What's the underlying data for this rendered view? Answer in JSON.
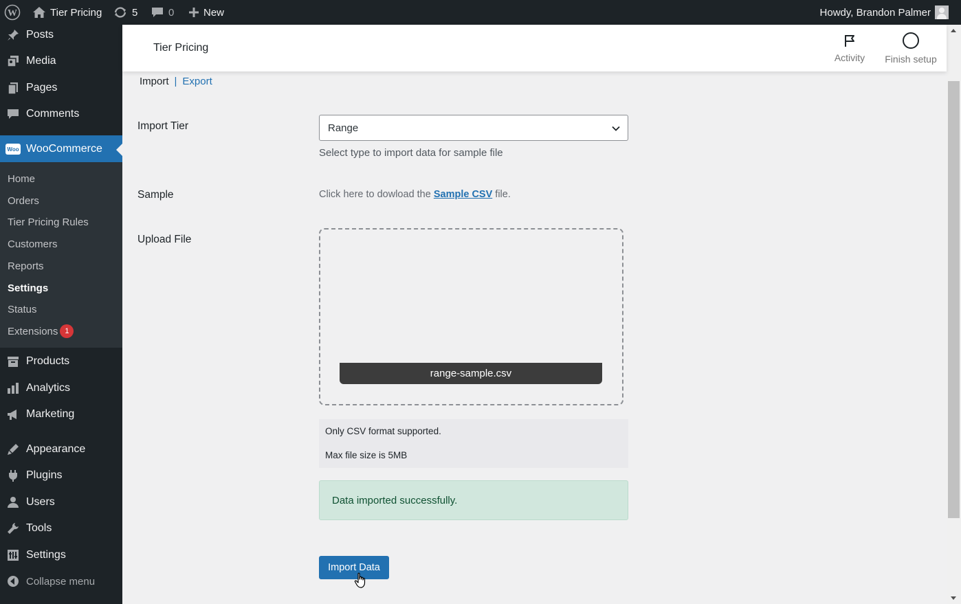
{
  "adminbar": {
    "site_name": "Tier Pricing",
    "updates_count": "5",
    "comments_count": "0",
    "new_label": "New",
    "howdy": "Howdy, Brandon Palmer"
  },
  "sidebar": {
    "top_items": [
      {
        "label": "Posts",
        "icon": "pin-icon"
      },
      {
        "label": "Media",
        "icon": "media-icon"
      },
      {
        "label": "Pages",
        "icon": "pages-icon"
      },
      {
        "label": "Comments",
        "icon": "comment-icon"
      }
    ],
    "woocommerce_label": "WooCommerce",
    "woocommerce_badge": "Woo",
    "submenu": [
      {
        "label": "Home"
      },
      {
        "label": "Orders"
      },
      {
        "label": "Tier Pricing Rules"
      },
      {
        "label": "Customers"
      },
      {
        "label": "Reports"
      },
      {
        "label": "Settings",
        "current": true
      },
      {
        "label": "Status"
      },
      {
        "label": "Extensions",
        "badge": "1"
      }
    ],
    "bottom_items": [
      {
        "label": "Products",
        "icon": "products-icon"
      },
      {
        "label": "Analytics",
        "icon": "analytics-icon"
      },
      {
        "label": "Marketing",
        "icon": "marketing-icon"
      },
      {
        "label": "Appearance",
        "icon": "appearance-icon"
      },
      {
        "label": "Plugins",
        "icon": "plugins-icon"
      },
      {
        "label": "Users",
        "icon": "users-icon"
      },
      {
        "label": "Tools",
        "icon": "tools-icon"
      },
      {
        "label": "Settings",
        "icon": "settings-icon"
      }
    ],
    "collapse_label": "Collapse menu"
  },
  "header": {
    "title": "Tier Pricing",
    "activity_label": "Activity",
    "finish_setup_label": "Finish setup"
  },
  "main": {
    "tabs": {
      "import": "Import",
      "separator": "|",
      "export": "Export"
    },
    "import_tier": {
      "label": "Import Tier",
      "selected": "Range",
      "help": "Select type to import data for sample file"
    },
    "sample": {
      "label": "Sample",
      "text_before": "Click here to dowload the ",
      "link_text": "Sample CSV",
      "text_after": " file."
    },
    "upload": {
      "label": "Upload File",
      "file_name": "range-sample.csv"
    },
    "info": {
      "line1": "Only CSV format supported.",
      "line2": "Max file size is 5MB"
    },
    "success_message": "Data imported successfully.",
    "import_button": "Import Data"
  },
  "colors": {
    "accent": "#2271b1",
    "admin_bg": "#1d2327",
    "success_bg": "#d1e7dd",
    "badge_red": "#d63638"
  }
}
